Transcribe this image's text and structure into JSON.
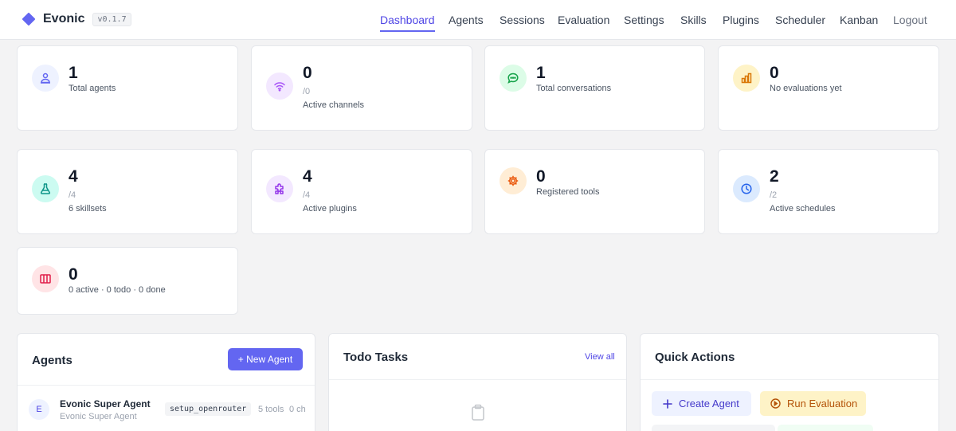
{
  "app": {
    "name": "Evonic",
    "version": "v0.1.7"
  },
  "nav": {
    "items": [
      "Dashboard",
      "Agents",
      "Sessions",
      "Evaluation",
      "Settings",
      "Skills",
      "Plugins",
      "Scheduler",
      "Kanban",
      "Logout"
    ],
    "active": "Dashboard"
  },
  "stats": [
    {
      "value": "1",
      "lines": [
        "Total agents"
      ],
      "icon": "agent-icon",
      "color": "#6366f1",
      "bg": "#eef2ff"
    },
    {
      "value": "0",
      "lines": [
        "/0",
        "Active channels"
      ],
      "icon": "wifi-icon",
      "color": "#a855f7",
      "bg": "#f3e8ff"
    },
    {
      "value": "1",
      "lines": [
        "Total conversations"
      ],
      "icon": "chat-icon",
      "color": "#16a34a",
      "bg": "#dcfce7"
    },
    {
      "value": "0",
      "lines": [
        "No evaluations yet"
      ],
      "icon": "bar-chart-icon",
      "color": "#d97706",
      "bg": "#fef3c7"
    },
    {
      "value": "4",
      "lines": [
        "/4",
        "6 skillsets"
      ],
      "icon": "flask-icon",
      "color": "#0d9488",
      "bg": "#ccfbf1"
    },
    {
      "value": "4",
      "lines": [
        "/4",
        "Active plugins"
      ],
      "icon": "puzzle-icon",
      "color": "#9333ea",
      "bg": "#f3e8ff"
    },
    {
      "value": "0",
      "lines": [
        "Registered tools"
      ],
      "icon": "gear-icon",
      "color": "#ea580c",
      "bg": "#ffedd5"
    },
    {
      "value": "2",
      "lines": [
        "/2",
        "Active schedules"
      ],
      "icon": "clock-icon",
      "color": "#2563eb",
      "bg": "#dbeafe"
    },
    {
      "value": "0",
      "lines": [
        "0 active · 0 todo · 0 done"
      ],
      "icon": "kanban-icon",
      "color": "#e11d48",
      "bg": "#ffe4e6"
    }
  ],
  "agents_panel": {
    "title": "Agents",
    "new_button": "+ New Agent",
    "rows": [
      {
        "avatar": "E",
        "name": "Evonic Super Agent",
        "subtitle": "Evonic Super Agent",
        "tool": "setup_openrouter",
        "tools_count": "5 tools",
        "channels": "0 ch"
      }
    ]
  },
  "todo_panel": {
    "title": "Todo Tasks",
    "view_all": "View all",
    "empty_icon": "clipboard-icon"
  },
  "quick_actions": {
    "title": "Quick Actions",
    "buttons": [
      {
        "label": "Create Agent",
        "icon": "plus-icon"
      },
      {
        "label": "Run Evaluation",
        "icon": "play-circle-icon"
      }
    ]
  }
}
